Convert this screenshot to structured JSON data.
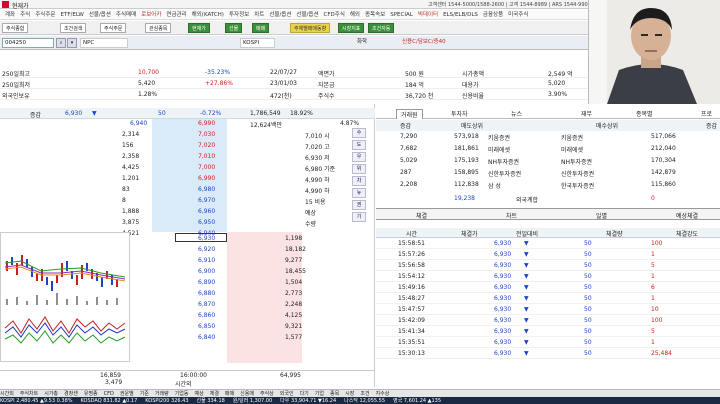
{
  "title_bar": {
    "title": "현재가",
    "info": "고객센터 1544-5000/1588-2600 | 고객 1544-8989 | ARS 1544-9900"
  },
  "menu": [
    "계좌",
    "주식",
    "주식주문",
    "ETF/ELW",
    "선물/옵션",
    "주식매매",
    "로보어카",
    "연금관리",
    "해외(KATCH)",
    "투자정보",
    "차트",
    "선물/옵션",
    "선물/옵션",
    "CFD주식",
    "해외",
    "종목속보",
    "SPECIAL",
    "빅데이터",
    "ELS/ELB/DLS",
    "금융상품",
    "미국주식"
  ],
  "toolbar": [
    "주식종합",
    "조건검색",
    "주식주문",
    "관심종목",
    "현재가",
    "선물",
    "매매",
    "주체별매매동향",
    "시장지표",
    "조건자동"
  ],
  "code_bar": {
    "code": "004250",
    "name": "NPC",
    "market": "KOSPI",
    "sector": "화학",
    "credit": "신용C/담보C/증40"
  },
  "info_rows": [
    {
      "a": "250일최고",
      "b": "10,700",
      "c": "-35.23%",
      "d": "22/07/27",
      "e": "액면가",
      "f": "500 원",
      "g": "시가총액",
      "h": "2,549 억",
      "i": "PBR"
    },
    {
      "a": "250일최저",
      "b": "5,420",
      "c": "+27.86%",
      "d": "23/01/03",
      "e": "자본금",
      "f": "184 억",
      "g": "대용가",
      "h": "5,020",
      "i": "PER"
    },
    {
      "a": "외국인보유",
      "b": "1.28%",
      "c": "",
      "d": "472(천)",
      "e": "주식수",
      "f": "36,720 천",
      "g": "신용비율",
      "h": "3.90%",
      "i": "결산월"
    }
  ],
  "orderbook": {
    "header": {
      "label": "증감",
      "price": "6,930",
      "up": "▼",
      "change": "50",
      "pct": "-0.72%",
      "volume": "1,786,549",
      "rate": "18.92%"
    },
    "sub": {
      "price": "6,940",
      "price2": "6,990",
      "vol": "12,624백만",
      "r": "4.87%"
    },
    "asks": [
      {
        "qty": "2,314",
        "price": "7,030",
        "info": "7,010 시"
      },
      {
        "qty": "156",
        "price": "7,020",
        "info": "7,020 고"
      },
      {
        "qty": "2,358",
        "price": "7,010",
        "info": "6,930 저"
      },
      {
        "qty": "4,425",
        "price": "7,000",
        "info": "6,980 기준"
      },
      {
        "qty": "1,201",
        "price": "6,990",
        "info": "4,990 하"
      },
      {
        "qty": "83",
        "price": "6,980",
        "info": "4,990 하"
      },
      {
        "qty": "8",
        "price": "6,970",
        "info": "15 비용"
      },
      {
        "qty": "1,888",
        "price": "6,960",
        "info": "예상"
      },
      {
        "qty": "3,875",
        "price": "6,950",
        "info": "수량"
      },
      {
        "qty": "4,521",
        "price": "6,940",
        "info": ""
      }
    ],
    "bids": [
      {
        "price": "6,930",
        "qty": "1,198"
      },
      {
        "price": "6,920",
        "qty": "18,182"
      },
      {
        "price": "6,910",
        "qty": "9,277"
      },
      {
        "price": "6,900",
        "qty": "18,455"
      },
      {
        "price": "6,890",
        "qty": "1,504"
      },
      {
        "price": "6,880",
        "qty": "2,773"
      },
      {
        "price": "6,870",
        "qty": "2,248"
      },
      {
        "price": "6,860",
        "qty": "4,125"
      },
      {
        "price": "6,850",
        "qty": "9,321"
      },
      {
        "price": "6,840",
        "qty": "1,577"
      }
    ],
    "footer": {
      "ask_total": "16,859",
      "time": "16:00:00",
      "bid_total": "64,995",
      "vol2": "3,479",
      "time_label": "시간외"
    },
    "side": [
      "수",
      "도",
      "우",
      "위",
      "차",
      "뉴",
      "권",
      "기"
    ]
  },
  "right_tabs": [
    "거래원",
    "투자자",
    "뉴스",
    "재무",
    "종목별",
    "프로"
  ],
  "brokers": {
    "header": {
      "sell": "매도상위",
      "buy": "매수상위",
      "c1": "증감",
      "c2": "증감"
    },
    "rows": [
      {
        "sq": "7,290",
        "s": "573,918",
        "sb": "키움증권",
        "bb": "키움증권",
        "bq": "517,066"
      },
      {
        "sq": "7,682",
        "s": "181,861",
        "sb": "미래에셋",
        "bb": "미래에셋",
        "bq": "212,040"
      },
      {
        "sq": "5,029",
        "s": "175,193",
        "sb": "NH투자증권",
        "bb": "NH투자증권",
        "bq": "170,304"
      },
      {
        "sq": "287",
        "s": "158,895",
        "sb": "신한투자증권",
        "bb": "신한투자증권",
        "bq": "142,879"
      },
      {
        "sq": "2,208",
        "s": "112,838",
        "sb": "삼 성",
        "bb": "한국투자증권",
        "bq": "115,860"
      }
    ],
    "foreign": {
      "q": "19,238",
      "label": "외국계합",
      "bq": "0"
    }
  },
  "trade_tabs": [
    "체결",
    "차트",
    "일별",
    "예상체결"
  ],
  "trades": {
    "header": [
      "시간",
      "체결가",
      "전일대비",
      "체결량",
      "체결강도"
    ],
    "rows": [
      {
        "t": "15:58:51",
        "p": "6,930",
        "d": "50",
        "q": "100"
      },
      {
        "t": "15:57:26",
        "p": "6,930",
        "d": "50",
        "q": "1"
      },
      {
        "t": "15:56:58",
        "p": "6,930",
        "d": "50",
        "q": "5"
      },
      {
        "t": "15:54:12",
        "p": "6,930",
        "d": "50",
        "q": "1"
      },
      {
        "t": "15:49:16",
        "p": "6,930",
        "d": "50",
        "q": "6"
      },
      {
        "t": "15:48:27",
        "p": "6,930",
        "d": "50",
        "q": "1"
      },
      {
        "t": "15:47:57",
        "p": "6,930",
        "d": "50",
        "q": "10"
      },
      {
        "t": "15:42:09",
        "p": "6,930",
        "d": "50",
        "q": "100"
      },
      {
        "t": "15:41:34",
        "p": "6,930",
        "d": "50",
        "q": "5"
      },
      {
        "t": "15:35:51",
        "p": "6,930",
        "d": "50",
        "q": "1"
      },
      {
        "t": "15:30:13",
        "p": "6,930",
        "d": "50",
        "q": "25,484"
      }
    ]
  },
  "bottom_tabs": [
    "시간외",
    "주식차트",
    "시가총",
    "경창센",
    "유명종",
    "CFD",
    "권운별",
    "기준",
    "거래량",
    "기업동",
    "예상",
    "체결",
    "매매",
    "신용매",
    "주식상",
    "외국인",
    "다기",
    "기업",
    "종목",
    "시장",
    "조건",
    "지수상"
  ],
  "ticker": [
    "KOSPI 2,480.45 ▲9.53 0.38%",
    "KOSDAQ 831.82 ▲0.17",
    "KOSPI200 326.43",
    "선물 334.18",
    "원/달러 1,307.00",
    "다우 33,904.71 ▼16.24",
    "나스닥 12,055.55",
    "영국 7,601.24 ▲135"
  ]
}
